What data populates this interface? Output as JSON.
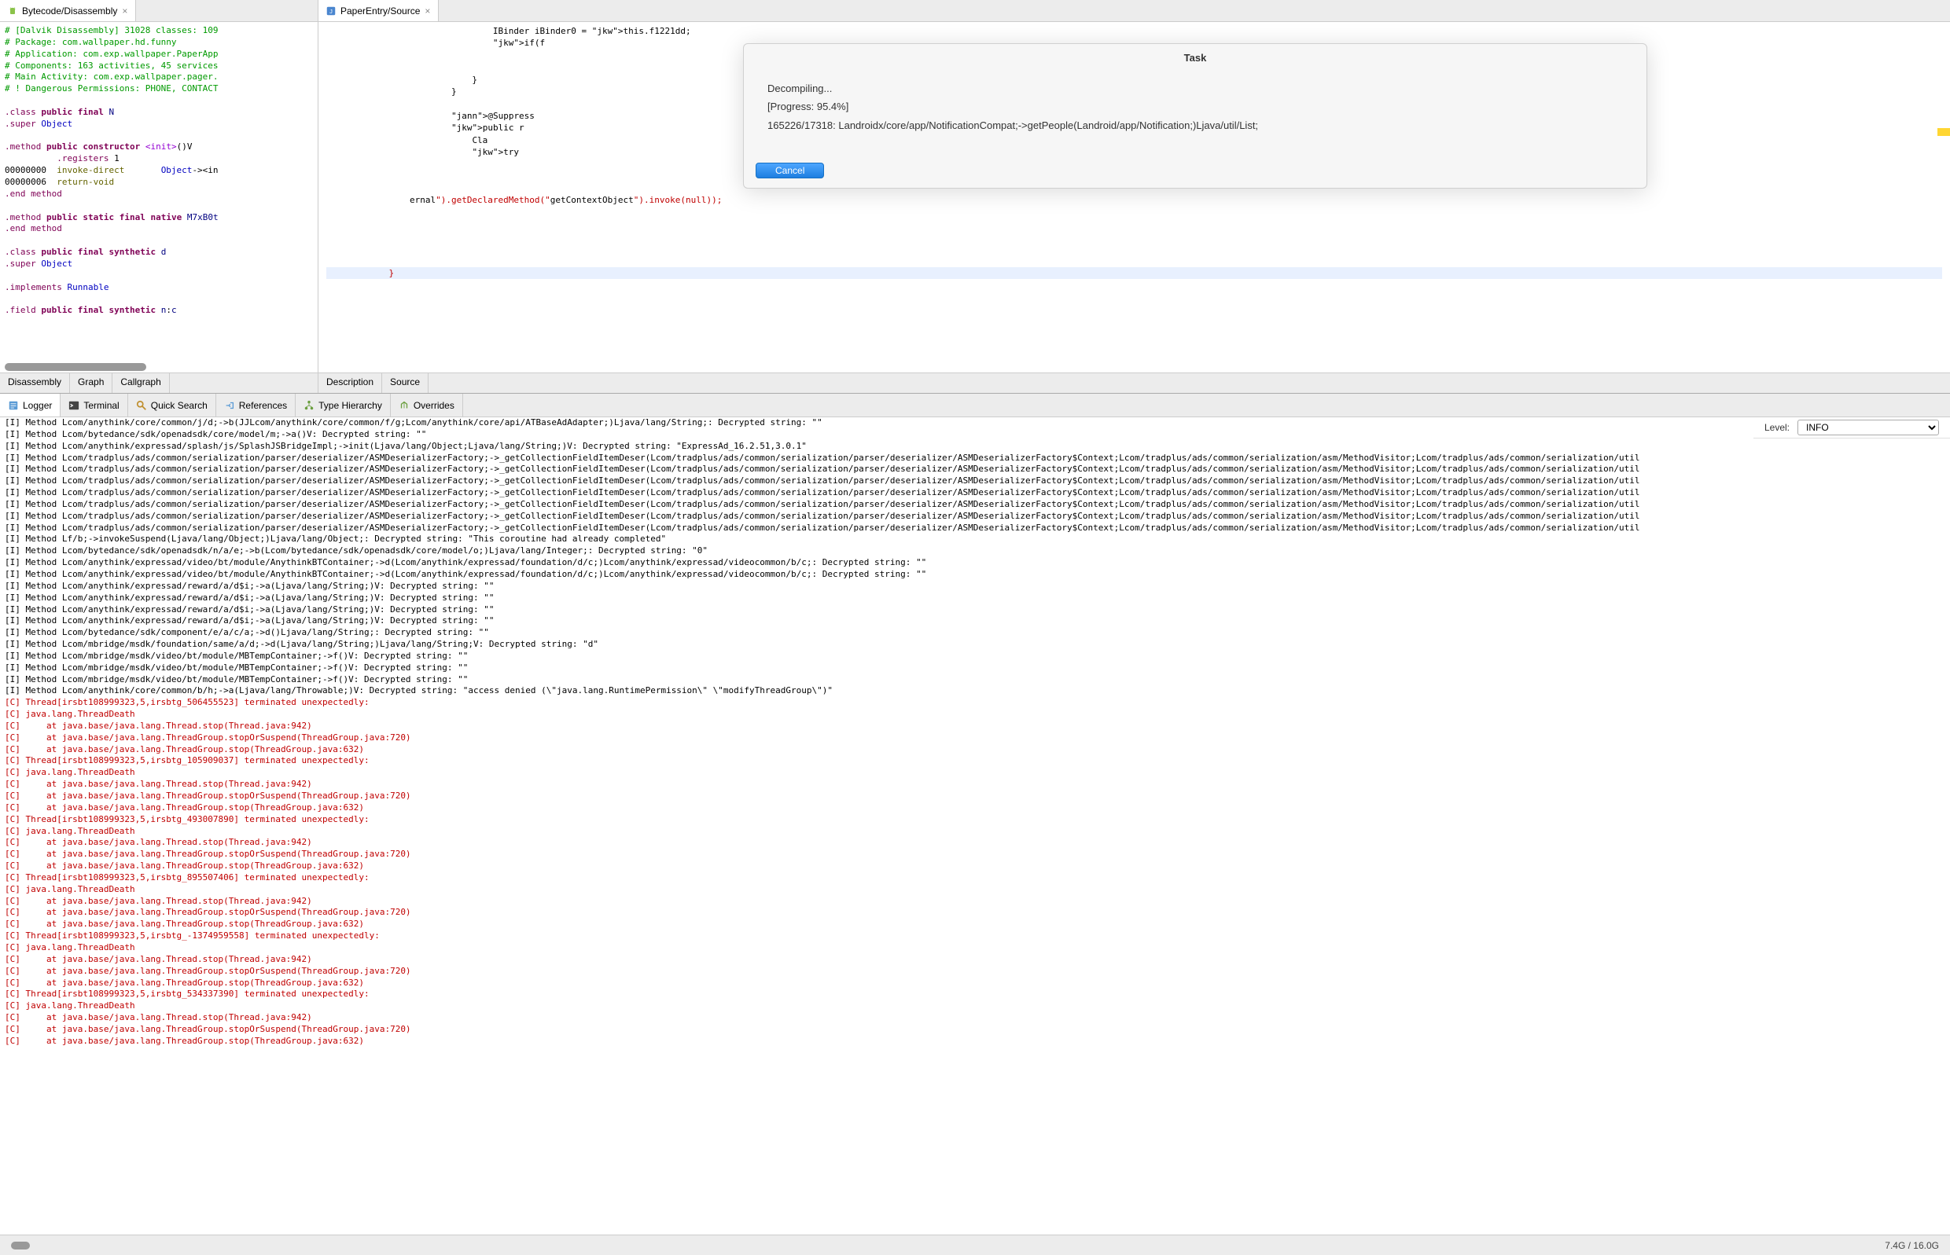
{
  "left_tab": {
    "label": "Bytecode/Disassembly"
  },
  "right_tab": {
    "label": "PaperEntry/Source"
  },
  "left_bottom_tabs": [
    "Disassembly",
    "Graph",
    "Callgraph"
  ],
  "right_bottom_tabs": [
    "Description",
    "Source"
  ],
  "disassembly": {
    "header": [
      "# [Dalvik Disassembly] 31028 classes: 109",
      "# Package: com.wallpaper.hd.funny",
      "# Application: com.exp.wallpaper.PaperApp",
      "# Components: 163 activities, 45 services",
      "# Main Activity: com.exp.wallpaper.pager.",
      "# ! Dangerous Permissions: PHONE, CONTACT"
    ],
    "lines": [
      ".class public final N",
      ".super Object",
      "",
      ".method public constructor <init>()V",
      "          .registers 1",
      "00000000  invoke-direct       Object-><in",
      "00000006  return-void",
      ".end method",
      "",
      ".method public static final native M7xB0t",
      ".end method",
      "",
      ".class public final synthetic d",
      ".super Object",
      "",
      ".implements Runnable",
      "",
      ".field public final synthetic n:c"
    ]
  },
  "java_source": {
    "lines": [
      "                IBinder iBinder0 = this.f1221dd;",
      "                if(f",
      "",
      "",
      "            }",
      "        }",
      "",
      "        @Suppress",
      "        public r",
      "            Cla",
      "            try",
      "",
      "",
      "",
      "ernal\").getDeclaredMethod(\"getContextObject\").invoke(null));",
      "",
      "",
      "            }"
    ]
  },
  "modal": {
    "title": "Task",
    "status": "Decompiling...",
    "progress": "[Progress: 95.4%]",
    "detail": "165226/17318: Landroidx/core/app/NotificationCompat;->getPeople(Landroid/app/Notification;)Ljava/util/List;",
    "cancel": "Cancel"
  },
  "logger_tabs": [
    {
      "label": "Logger",
      "icon": "log-icon"
    },
    {
      "label": "Terminal",
      "icon": "terminal-icon"
    },
    {
      "label": "Quick Search",
      "icon": "search-icon"
    },
    {
      "label": "References",
      "icon": "refs-icon"
    },
    {
      "label": "Type Hierarchy",
      "icon": "hierarchy-icon"
    },
    {
      "label": "Overrides",
      "icon": "overrides-icon"
    }
  ],
  "level": {
    "label": "Level:",
    "value": "INFO"
  },
  "log_lines": [
    {
      "t": "I",
      "txt": "[I] Method Lcom/anythink/core/common/j/d;->b(JJLcom/anythink/core/common/f/g;Lcom/anythink/core/api/ATBaseAdAdapter;)Ljava/lang/String;: Decrypted string: \"\""
    },
    {
      "t": "I",
      "txt": "[I] Method Lcom/bytedance/sdk/openadsdk/core/model/m;->a()V: Decrypted string: \"\""
    },
    {
      "t": "I",
      "txt": "[I] Method Lcom/anythink/expressad/splash/js/SplashJSBridgeImpl;->init(Ljava/lang/Object;Ljava/lang/String;)V: Decrypted string: \"ExpressAd_16.2.51,3.0.1\""
    },
    {
      "t": "I",
      "txt": "[I] Method Lcom/tradplus/ads/common/serialization/parser/deserializer/ASMDeserializerFactory;->_getCollectionFieldItemDeser(Lcom/tradplus/ads/common/serialization/parser/deserializer/ASMDeserializerFactory$Context;Lcom/tradplus/ads/common/serialization/asm/MethodVisitor;Lcom/tradplus/ads/common/serialization/util"
    },
    {
      "t": "I",
      "txt": "[I] Method Lcom/tradplus/ads/common/serialization/parser/deserializer/ASMDeserializerFactory;->_getCollectionFieldItemDeser(Lcom/tradplus/ads/common/serialization/parser/deserializer/ASMDeserializerFactory$Context;Lcom/tradplus/ads/common/serialization/asm/MethodVisitor;Lcom/tradplus/ads/common/serialization/util"
    },
    {
      "t": "I",
      "txt": "[I] Method Lcom/tradplus/ads/common/serialization/parser/deserializer/ASMDeserializerFactory;->_getCollectionFieldItemDeser(Lcom/tradplus/ads/common/serialization/parser/deserializer/ASMDeserializerFactory$Context;Lcom/tradplus/ads/common/serialization/asm/MethodVisitor;Lcom/tradplus/ads/common/serialization/util"
    },
    {
      "t": "I",
      "txt": "[I] Method Lcom/tradplus/ads/common/serialization/parser/deserializer/ASMDeserializerFactory;->_getCollectionFieldItemDeser(Lcom/tradplus/ads/common/serialization/parser/deserializer/ASMDeserializerFactory$Context;Lcom/tradplus/ads/common/serialization/asm/MethodVisitor;Lcom/tradplus/ads/common/serialization/util"
    },
    {
      "t": "I",
      "txt": "[I] Method Lcom/tradplus/ads/common/serialization/parser/deserializer/ASMDeserializerFactory;->_getCollectionFieldItemDeser(Lcom/tradplus/ads/common/serialization/parser/deserializer/ASMDeserializerFactory$Context;Lcom/tradplus/ads/common/serialization/asm/MethodVisitor;Lcom/tradplus/ads/common/serialization/util"
    },
    {
      "t": "I",
      "txt": "[I] Method Lcom/tradplus/ads/common/serialization/parser/deserializer/ASMDeserializerFactory;->_getCollectionFieldItemDeser(Lcom/tradplus/ads/common/serialization/parser/deserializer/ASMDeserializerFactory$Context;Lcom/tradplus/ads/common/serialization/asm/MethodVisitor;Lcom/tradplus/ads/common/serialization/util"
    },
    {
      "t": "I",
      "txt": "[I] Method Lcom/tradplus/ads/common/serialization/parser/deserializer/ASMDeserializerFactory;->_getCollectionFieldItemDeser(Lcom/tradplus/ads/common/serialization/parser/deserializer/ASMDeserializerFactory$Context;Lcom/tradplus/ads/common/serialization/asm/MethodVisitor;Lcom/tradplus/ads/common/serialization/util"
    },
    {
      "t": "I",
      "txt": "[I] Method Lf/b;->invokeSuspend(Ljava/lang/Object;)Ljava/lang/Object;: Decrypted string: \"This coroutine had already completed\""
    },
    {
      "t": "I",
      "txt": "[I] Method Lcom/bytedance/sdk/openadsdk/n/a/e;->b(Lcom/bytedance/sdk/openadsdk/core/model/o;)Ljava/lang/Integer;: Decrypted string: \"0\""
    },
    {
      "t": "I",
      "txt": "[I] Method Lcom/anythink/expressad/video/bt/module/AnythinkBTContainer;->d(Lcom/anythink/expressad/foundation/d/c;)Lcom/anythink/expressad/videocommon/b/c;: Decrypted string: \"\""
    },
    {
      "t": "I",
      "txt": "[I] Method Lcom/anythink/expressad/video/bt/module/AnythinkBTContainer;->d(Lcom/anythink/expressad/foundation/d/c;)Lcom/anythink/expressad/videocommon/b/c;: Decrypted string: \"\""
    },
    {
      "t": "I",
      "txt": "[I] Method Lcom/anythink/expressad/reward/a/d$i;->a(Ljava/lang/String;)V: Decrypted string: \"\""
    },
    {
      "t": "I",
      "txt": "[I] Method Lcom/anythink/expressad/reward/a/d$i;->a(Ljava/lang/String;)V: Decrypted string: \"\""
    },
    {
      "t": "I",
      "txt": "[I] Method Lcom/anythink/expressad/reward/a/d$i;->a(Ljava/lang/String;)V: Decrypted string: \"\""
    },
    {
      "t": "I",
      "txt": "[I] Method Lcom/anythink/expressad/reward/a/d$i;->a(Ljava/lang/String;)V: Decrypted string: \"\""
    },
    {
      "t": "I",
      "txt": "[I] Method Lcom/bytedance/sdk/component/e/a/c/a;->d()Ljava/lang/String;: Decrypted string: \"\""
    },
    {
      "t": "I",
      "txt": "[I] Method Lcom/mbridge/msdk/foundation/same/a/d;->d(Ljava/lang/String;)Ljava/lang/String;V: Decrypted string: \"d\""
    },
    {
      "t": "I",
      "txt": "[I] Method Lcom/mbridge/msdk/video/bt/module/MBTempContainer;->f()V: Decrypted string: \"\""
    },
    {
      "t": "I",
      "txt": "[I] Method Lcom/mbridge/msdk/video/bt/module/MBTempContainer;->f()V: Decrypted string: \"\""
    },
    {
      "t": "I",
      "txt": "[I] Method Lcom/mbridge/msdk/video/bt/module/MBTempContainer;->f()V: Decrypted string: \"\""
    },
    {
      "t": "I",
      "txt": "[I] Method Lcom/anythink/core/common/b/h;->a(Ljava/lang/Throwable;)V: Decrypted string: \"access denied (\\\"java.lang.RuntimePermission\\\" \\\"modifyThreadGroup\\\")\""
    },
    {
      "t": "C",
      "txt": "[C] Thread[irsbt108999323,5,irsbtg_506455523] terminated unexpectedly:"
    },
    {
      "t": "C",
      "txt": "[C] java.lang.ThreadDeath"
    },
    {
      "t": "C",
      "txt": "[C]     at java.base/java.lang.Thread.stop(Thread.java:942)"
    },
    {
      "t": "C",
      "txt": "[C]     at java.base/java.lang.ThreadGroup.stopOrSuspend(ThreadGroup.java:720)"
    },
    {
      "t": "C",
      "txt": "[C]     at java.base/java.lang.ThreadGroup.stop(ThreadGroup.java:632)"
    },
    {
      "t": "C",
      "txt": "[C] Thread[irsbt108999323,5,irsbtg_105909037] terminated unexpectedly:"
    },
    {
      "t": "C",
      "txt": "[C] java.lang.ThreadDeath"
    },
    {
      "t": "C",
      "txt": "[C]     at java.base/java.lang.Thread.stop(Thread.java:942)"
    },
    {
      "t": "C",
      "txt": "[C]     at java.base/java.lang.ThreadGroup.stopOrSuspend(ThreadGroup.java:720)"
    },
    {
      "t": "C",
      "txt": "[C]     at java.base/java.lang.ThreadGroup.stop(ThreadGroup.java:632)"
    },
    {
      "t": "C",
      "txt": "[C] Thread[irsbt108999323,5,irsbtg_493007890] terminated unexpectedly:"
    },
    {
      "t": "C",
      "txt": "[C] java.lang.ThreadDeath"
    },
    {
      "t": "C",
      "txt": "[C]     at java.base/java.lang.Thread.stop(Thread.java:942)"
    },
    {
      "t": "C",
      "txt": "[C]     at java.base/java.lang.ThreadGroup.stopOrSuspend(ThreadGroup.java:720)"
    },
    {
      "t": "C",
      "txt": "[C]     at java.base/java.lang.ThreadGroup.stop(ThreadGroup.java:632)"
    },
    {
      "t": "C",
      "txt": "[C] Thread[irsbt108999323,5,irsbtg_895507406] terminated unexpectedly:"
    },
    {
      "t": "C",
      "txt": "[C] java.lang.ThreadDeath"
    },
    {
      "t": "C",
      "txt": "[C]     at java.base/java.lang.Thread.stop(Thread.java:942)"
    },
    {
      "t": "C",
      "txt": "[C]     at java.base/java.lang.ThreadGroup.stopOrSuspend(ThreadGroup.java:720)"
    },
    {
      "t": "C",
      "txt": "[C]     at java.base/java.lang.ThreadGroup.stop(ThreadGroup.java:632)"
    },
    {
      "t": "C",
      "txt": "[C] Thread[irsbt108999323,5,irsbtg_-1374959558] terminated unexpectedly:"
    },
    {
      "t": "C",
      "txt": "[C] java.lang.ThreadDeath"
    },
    {
      "t": "C",
      "txt": "[C]     at java.base/java.lang.Thread.stop(Thread.java:942)"
    },
    {
      "t": "C",
      "txt": "[C]     at java.base/java.lang.ThreadGroup.stopOrSuspend(ThreadGroup.java:720)"
    },
    {
      "t": "C",
      "txt": "[C]     at java.base/java.lang.ThreadGroup.stop(ThreadGroup.java:632)"
    },
    {
      "t": "C",
      "txt": "[C] Thread[irsbt108999323,5,irsbtg_534337390] terminated unexpectedly:"
    },
    {
      "t": "C",
      "txt": "[C] java.lang.ThreadDeath"
    },
    {
      "t": "C",
      "txt": "[C]     at java.base/java.lang.Thread.stop(Thread.java:942)"
    },
    {
      "t": "C",
      "txt": "[C]     at java.base/java.lang.ThreadGroup.stopOrSuspend(ThreadGroup.java:720)"
    },
    {
      "t": "C",
      "txt": "[C]     at java.base/java.lang.ThreadGroup.stop(ThreadGroup.java:632)"
    }
  ],
  "status": {
    "mem": "7.4G / 16.0G"
  }
}
